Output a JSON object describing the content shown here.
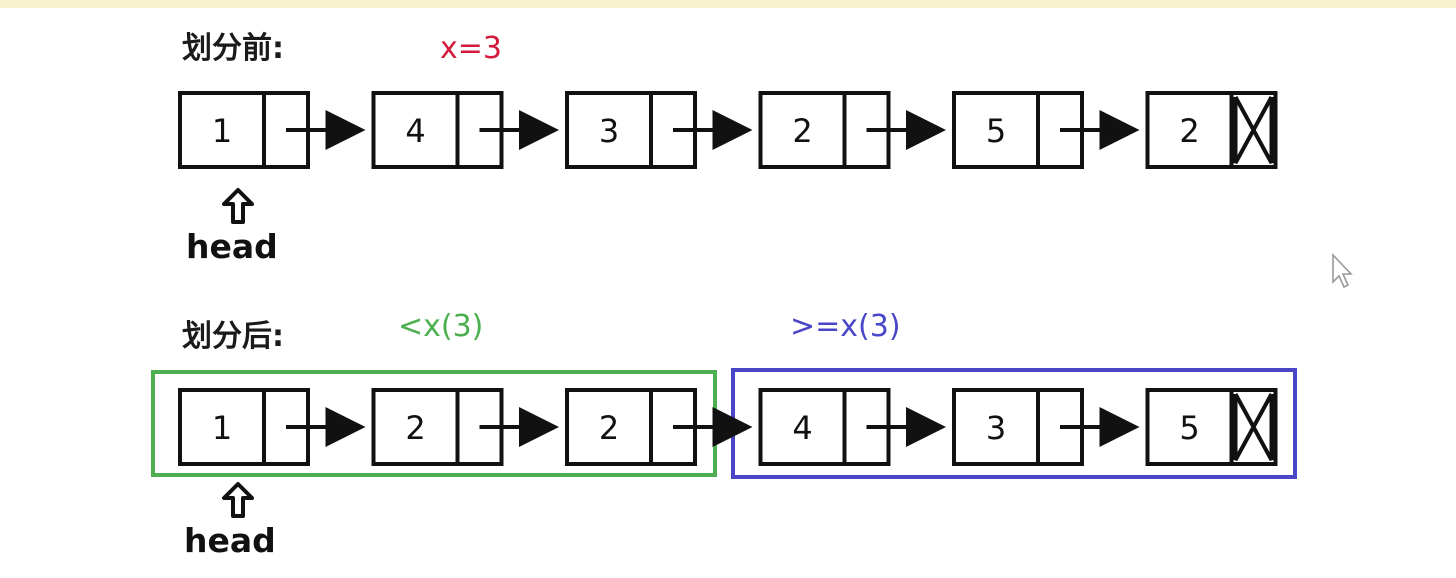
{
  "top_strip_color": "#f2e7b0",
  "before": {
    "title": "划分前:",
    "condition": "x=3",
    "condition_color": "#d11a3c",
    "nodes": [
      "1",
      "4",
      "3",
      "2",
      "5",
      "2"
    ],
    "null_symbol": "N",
    "head_label": "head"
  },
  "after": {
    "title": "划分后:",
    "less_group_label": "<x(3)",
    "less_group_color": "#4caf50",
    "greater_group_label": ">=x(3)",
    "greater_group_color": "#4a46c8",
    "nodes": [
      "1",
      "2",
      "2",
      "4",
      "3",
      "5"
    ],
    "null_symbol": "N",
    "head_label": "head"
  },
  "arrow_icon": "up-outline-arrow-icon",
  "cursor_icon": "mouse-pointer-icon"
}
